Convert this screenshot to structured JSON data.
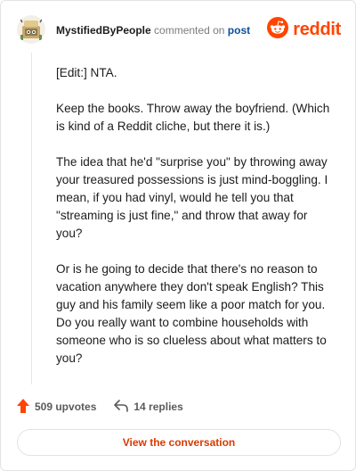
{
  "header": {
    "username": "MystifiedByPeople",
    "action_text": "commented on",
    "post_link": "post",
    "brand_name": "reddit",
    "avatar_icon": "snoo-avatar-icon",
    "logo_icon": "reddit-alien-logo-icon"
  },
  "comment": {
    "paragraphs": [
      "[Edit:] NTA.",
      "Keep the books. Throw away the boyfriend. (Which is kind of a Reddit cliche, but there it is.)",
      "The idea that he'd \"surprise you\" by throwing away your treasured possessions is just mind-boggling. I mean, if you had vinyl, would he tell you that \"streaming is just fine,\" and throw that away for you?",
      "Or is he going to decide that there's no reason to vacation anywhere they don't speak English? This guy and his family seem like a poor match for you. Do you really want to combine households with someone who is so clueless about what matters to you?"
    ]
  },
  "footer": {
    "upvotes": "509 upvotes",
    "replies": "14 replies",
    "upvote_icon": "upvote-arrow-icon",
    "reply_icon": "reply-arrow-icon"
  },
  "cta": {
    "label": "View the conversation"
  },
  "colors": {
    "brand": "#ff4500",
    "link": "#0a4f9c",
    "cta_text": "#d93a00",
    "muted": "#7c7c7c"
  }
}
